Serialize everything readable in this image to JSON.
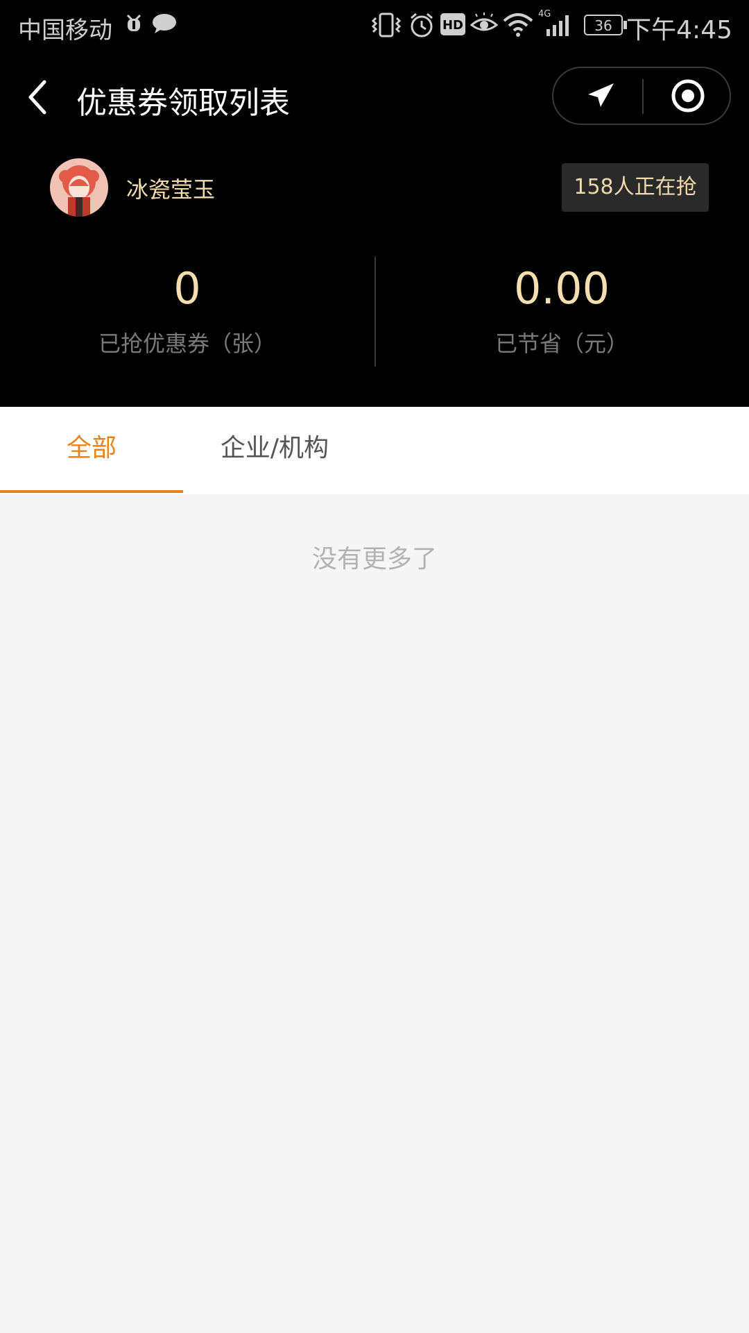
{
  "status_bar": {
    "carrier": "中国移动",
    "battery": "36",
    "network": "4G",
    "hd": "HD",
    "time": "下午4:45"
  },
  "nav": {
    "title": "优惠券领取列表"
  },
  "profile": {
    "username": "冰瓷莹玉",
    "grab_count": "158人正在抢"
  },
  "stats": {
    "coupons_value": "0",
    "coupons_label": "已抢优惠券（张）",
    "saved_value": "0.00",
    "saved_label": "已节省（元）"
  },
  "tabs": [
    {
      "label": "全部",
      "active": true
    },
    {
      "label": "企业/机构",
      "active": false
    }
  ],
  "empty_text": "没有更多了",
  "colors": {
    "accent": "#e8841d",
    "gold_text": "#f5dfb0",
    "header_bg": "#000000",
    "page_bg": "#f5f5f5"
  }
}
